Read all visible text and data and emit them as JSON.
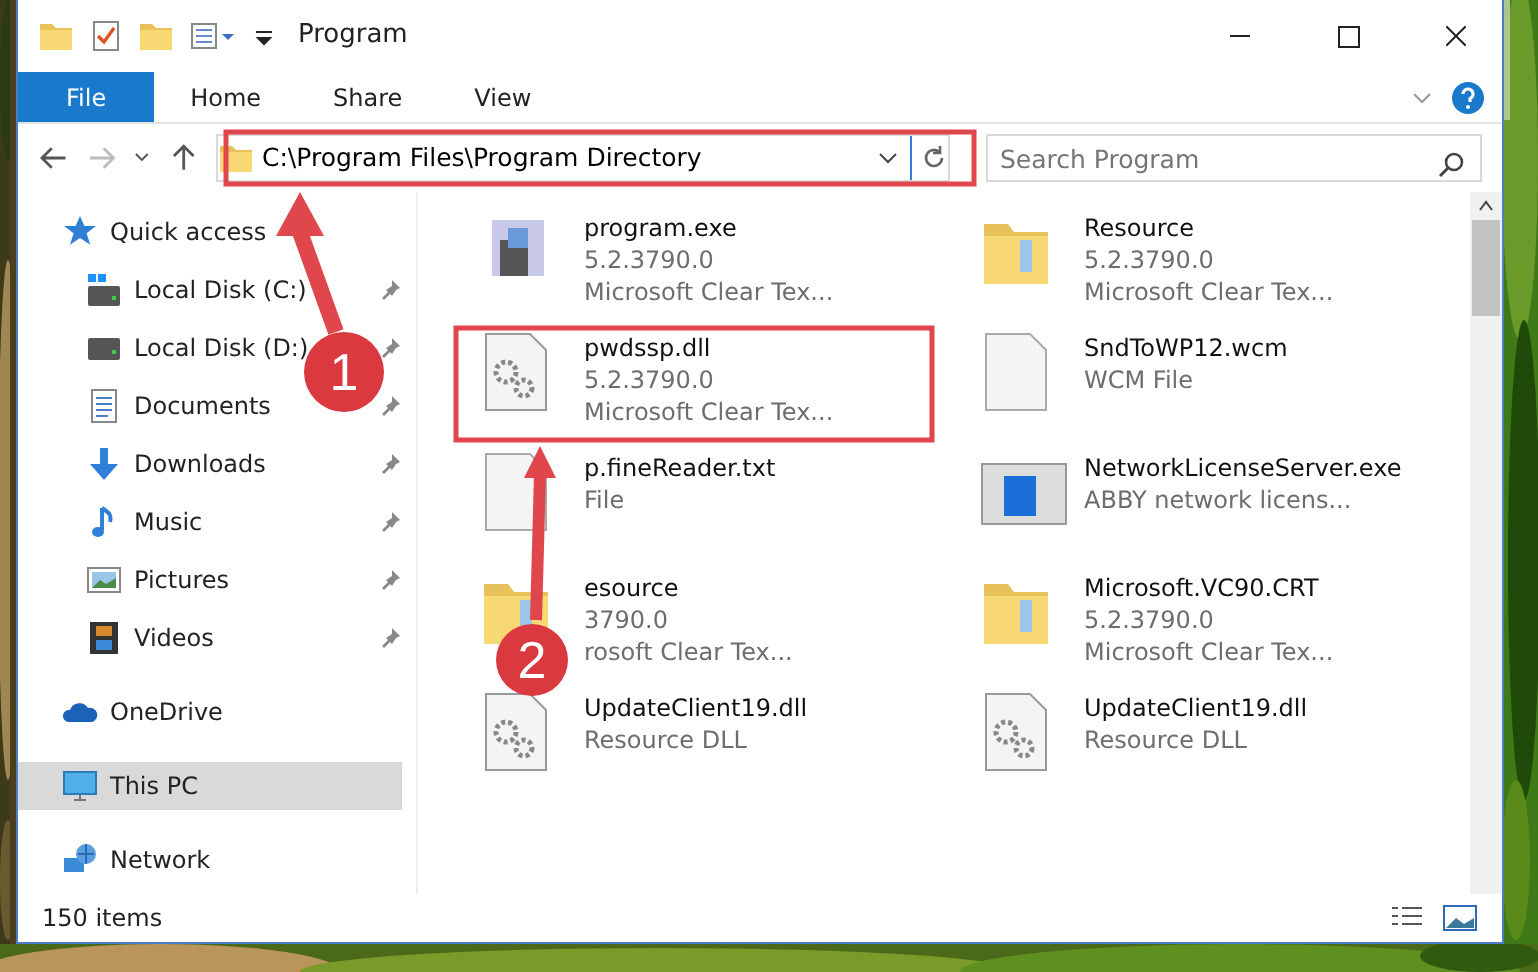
{
  "window": {
    "title": "Program"
  },
  "ribbon_tabs": [
    {
      "label": "File",
      "kind": "file",
      "selected": false
    },
    {
      "label": "Home",
      "kind": "tab",
      "selected": false
    },
    {
      "label": "Share",
      "kind": "tab",
      "selected": false
    },
    {
      "label": "View",
      "kind": "tab",
      "selected": false
    }
  ],
  "address_bar": {
    "value": "C:\\Program Files\\Program Directory"
  },
  "search": {
    "placeholder": "Search Program"
  },
  "navigation": [
    {
      "label": "Quick access",
      "kind": "quick",
      "selected": false,
      "children": [
        {
          "label": "Local Disk (C:)",
          "kind": "diskc",
          "pinned": true
        },
        {
          "label": "Local Disk (D:)",
          "kind": "disk",
          "pinned": true
        },
        {
          "label": "Documents",
          "kind": "docs",
          "pinned": true
        },
        {
          "label": "Downloads",
          "kind": "down",
          "pinned": true
        },
        {
          "label": "Music",
          "kind": "music",
          "pinned": true
        },
        {
          "label": "Pictures",
          "kind": "pics",
          "pinned": true
        },
        {
          "label": "Videos",
          "kind": "video",
          "pinned": true
        }
      ]
    },
    {
      "label": "OneDrive",
      "kind": "cloud",
      "selected": false
    },
    {
      "label": "This PC",
      "kind": "pc",
      "selected": true
    },
    {
      "label": "Network",
      "kind": "net",
      "selected": false
    }
  ],
  "files": [
    {
      "name": "program.exe",
      "details": [
        "5.2.3790.0",
        "Microsoft Clear Tex..."
      ],
      "kind": "exe"
    },
    {
      "name": "Resource",
      "details": [
        "5.2.3790.0",
        "Microsoft Clear Tex..."
      ],
      "kind": "folder"
    },
    {
      "name": "pwdssp.dll",
      "details": [
        "5.2.3790.0",
        "Microsoft Clear Tex..."
      ],
      "kind": "dll"
    },
    {
      "name": "SndToWP12.wcm",
      "details": [
        "WCM File"
      ],
      "kind": "blank"
    },
    {
      "name": "p.fineReader.txt",
      "details": [
        "File"
      ],
      "kind": "blank"
    },
    {
      "name": "NetworkLicenseServer.exe",
      "details": [
        "ABBY network licens..."
      ],
      "kind": "app"
    },
    {
      "name": "esource",
      "details": [
        "3790.0",
        "rosoft Clear Tex..."
      ],
      "kind": "folder"
    },
    {
      "name": "Microsoft.VC90.CRT",
      "details": [
        "5.2.3790.0",
        "Microsoft Clear Tex..."
      ],
      "kind": "folder"
    },
    {
      "name": "UpdateClient19.dll",
      "details": [
        "Resource DLL"
      ],
      "kind": "dll"
    },
    {
      "name": "UpdateClient19.dll",
      "details": [
        "Resource DLL"
      ],
      "kind": "dll"
    }
  ],
  "status_bar": {
    "count": "150 items"
  },
  "annotations": [
    {
      "number": "1"
    },
    {
      "number": "2"
    }
  ]
}
